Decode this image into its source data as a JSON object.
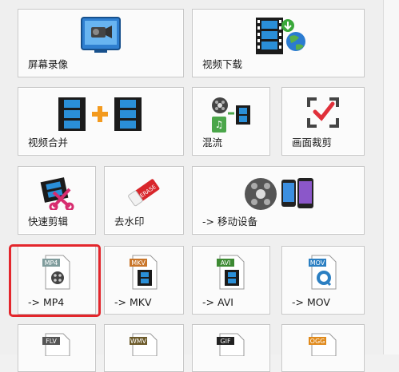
{
  "tiles": {
    "screen_record": {
      "label": "屏幕录像",
      "icon": "screen-recorder-icon"
    },
    "video_download": {
      "label": "视频下载",
      "icon": "video-download-icon"
    },
    "video_merge": {
      "label": "视频合并",
      "icon": "video-merge-icon"
    },
    "mix": {
      "label": "混流",
      "icon": "mux-icon"
    },
    "crop": {
      "label": "画面裁剪",
      "icon": "crop-icon"
    },
    "quick_cut": {
      "label": "快速剪辑",
      "icon": "quick-cut-icon"
    },
    "remove_watermark": {
      "label": "去水印",
      "icon": "eraser-icon"
    },
    "mobile": {
      "label": "-> 移动设备",
      "icon": "mobile-devices-icon"
    },
    "mp4": {
      "label": "-> MP4",
      "badge": "MP4",
      "icon": "mp4-file-icon"
    },
    "mkv": {
      "label": "-> MKV",
      "badge": "MKV",
      "icon": "mkv-file-icon"
    },
    "avi": {
      "label": "-> AVI",
      "badge": "AVI",
      "icon": "avi-file-icon"
    },
    "mov": {
      "label": "-> MOV",
      "badge": "MOV",
      "icon": "mov-file-icon"
    },
    "flv": {
      "badge": "FLV",
      "icon": "flv-file-icon"
    },
    "wmv": {
      "badge": "WMV",
      "icon": "wmv-file-icon"
    },
    "gif": {
      "badge": "GIF",
      "icon": "gif-file-icon"
    },
    "ogg": {
      "badge": "OGG",
      "icon": "ogg-file-icon"
    }
  },
  "colors": {
    "highlight": "#e3262c",
    "mp4_badge": "#7f9c9c",
    "mkv_badge": "#c9762a",
    "avi_badge": "#3d8a33",
    "mov_badge": "#2b7fc2",
    "flv_badge": "#555555",
    "wmv_badge": "#6c5a2a",
    "gif_badge": "#222222",
    "ogg_badge": "#e08a1c"
  }
}
